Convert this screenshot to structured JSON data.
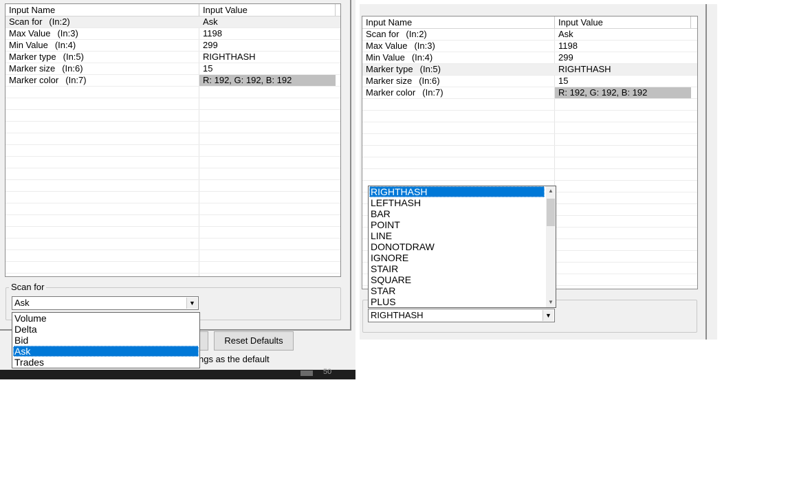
{
  "headers": {
    "name": "Input Name",
    "value": "Input Value"
  },
  "rows": [
    {
      "name": "Scan for",
      "line": "(In:2)",
      "value": "Ask"
    },
    {
      "name": "Max Value",
      "line": "(In:3)",
      "value": "1198"
    },
    {
      "name": "Min Value",
      "line": "(In:4)",
      "value": "299"
    },
    {
      "name": "Marker type",
      "line": "(In:5)",
      "value": "RIGHTHASH"
    },
    {
      "name": "Marker size",
      "line": "(In:6)",
      "value": "15"
    },
    {
      "name": "Marker color",
      "line": "(In:7)",
      "value": "R: 192, G: 192, B: 192"
    }
  ],
  "left": {
    "group_label": "Scan for",
    "combo_value": "Ask",
    "options": [
      "Volume",
      "Delta",
      "Bid",
      "Ask",
      "Trades"
    ],
    "selected_option": "Ask",
    "reset_button": "Reset Defaults",
    "default_text": "ngs as the default",
    "taskbar_fragment": "50"
  },
  "right": {
    "combo_value": "RIGHTHASH",
    "options": [
      "RIGHTHASH",
      "LEFTHASH",
      "BAR",
      "POINT",
      "LINE",
      "DONOTDRAW",
      "IGNORE",
      "STAIR",
      "SQUARE",
      "STAR",
      "PLUS"
    ],
    "selected_option": "RIGHTHASH"
  },
  "colors": {
    "highlight": "#0078d7",
    "marker_color_cell": "#c0c0c0",
    "panel": "#f0f0f0"
  }
}
